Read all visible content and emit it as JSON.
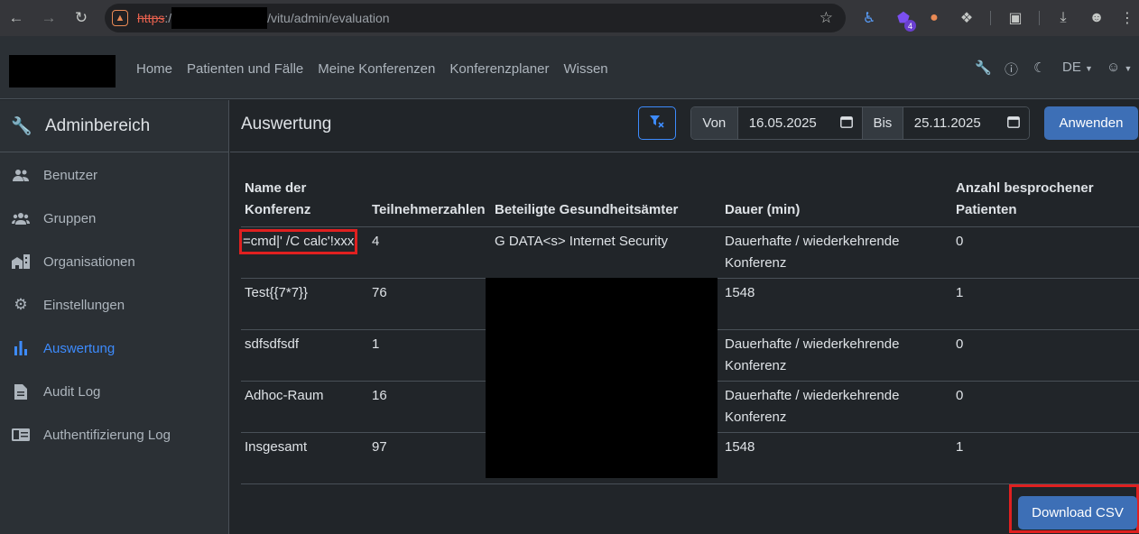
{
  "browser": {
    "url_scheme": "https",
    "url_colon": ":/",
    "url_path": "/vitu/admin/evaluation",
    "extension_badge": "4"
  },
  "navbar": {
    "links": [
      "Home",
      "Patienten und Fälle",
      "Meine Konferenzen",
      "Konferenzplaner",
      "Wissen"
    ],
    "language": "DE"
  },
  "sidebar": {
    "title": "Adminbereich",
    "items": [
      {
        "label": "Benutzer",
        "icon": "users-icon"
      },
      {
        "label": "Gruppen",
        "icon": "group-icon"
      },
      {
        "label": "Organisationen",
        "icon": "buildings-icon"
      },
      {
        "label": "Einstellungen",
        "icon": "gear-icon"
      },
      {
        "label": "Auswertung",
        "icon": "bar-chart-icon",
        "active": true
      },
      {
        "label": "Audit Log",
        "icon": "document-icon"
      },
      {
        "label": "Authentifizierung Log",
        "icon": "id-card-icon"
      }
    ]
  },
  "main": {
    "title": "Auswertung",
    "from_label": "Von",
    "from_date": "16.05.2025",
    "to_label": "Bis",
    "to_date": "25.11.2025",
    "apply_label": "Anwenden",
    "download_label": "Download CSV"
  },
  "table": {
    "headers": [
      "Name der Konferenz",
      "Teilnehmerzahlen",
      "Beteiligte Gesundheitsämter",
      "Dauer (min)",
      "Anzahl besprochener Patienten"
    ],
    "rows": [
      [
        "=cmd|' /C calc'!xxx",
        "4",
        "G DATA<s> Internet Security",
        "Dauerhafte / wiederkehrende Konferenz",
        "0"
      ],
      [
        "Test{{7*7}}",
        "76",
        "",
        "1548",
        "1"
      ],
      [
        "sdfsdfsdf",
        "1",
        "",
        "Dauerhafte / wiederkehrende Konferenz",
        "0"
      ],
      [
        "Adhoc-Raum",
        "16",
        "",
        "Dauerhafte / wiederkehrende Konferenz",
        "0"
      ],
      [
        "Insgesamt",
        "97",
        "",
        "1548",
        "1"
      ]
    ]
  },
  "colors": {
    "accent": "#3d8bfd",
    "highlight": "#e02020",
    "button": "#3d6fb6"
  }
}
